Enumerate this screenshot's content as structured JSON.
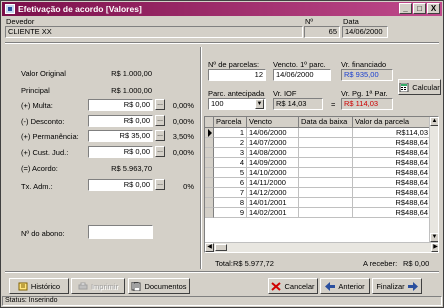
{
  "window": {
    "title": "Efetivação de acordo [Valores]",
    "controls": [
      "_",
      "□",
      "X"
    ]
  },
  "header": {
    "devedor_label": "Devedor",
    "devedor_value": "CLIENTE XX",
    "numero_label": "Nº",
    "numero_value": "65",
    "data_label": "Data",
    "data_value": "14/06/2000"
  },
  "values": {
    "valor_original_label": "Valor Original",
    "valor_original": "R$ 1.000,00",
    "principal_label": "Principal",
    "principal": "R$ 1.000,00",
    "multa_label": "(+) Multa:",
    "multa": "R$ 0,00",
    "multa_pct": "0,00%",
    "desconto_label": "(-) Desconto:",
    "desconto": "R$ 0,00",
    "desconto_pct": "0,00%",
    "permanencia_label": "(+) Permanência:",
    "permanencia": "R$ 35,00",
    "permanencia_pct": "3,50%",
    "custjud_label": "(+) Cust. Jud.:",
    "custjud": "R$ 0,00",
    "custjud_pct": "0,00%",
    "acordo_label": "(=) Acordo:",
    "acordo": "R$ 5.963,70",
    "txadm_label": "Tx. Adm.:",
    "txadm": "R$ 0,00",
    "txadm_pct": "0%",
    "abono_label": "Nº do abono:",
    "abono_value": ""
  },
  "parcelas": {
    "num_label": "Nº de parcelas:",
    "num_value": "12",
    "venc_label": "Vencto. 1º parc.",
    "venc_value": "14/06/2000",
    "financiado_label": "Vr. financiado",
    "financiado_value": "R$ 935,00",
    "antecipada_label": "Parc. antecipada",
    "antecipada_value": "100",
    "iof_label": "Vr. IOF",
    "iof_value": "R$ 14,03",
    "eq_sign": "=",
    "vrpg_label": "Vr. Pg. 1ª Par.",
    "vrpg_value": "R$ 114,03",
    "calcular_label": "Calcular"
  },
  "grid": {
    "columns": [
      "Parcela",
      "Vencto",
      "Data da baixa",
      "Valor da parcela"
    ],
    "rows": [
      {
        "parcela": "1",
        "vencto": "14/06/2000",
        "baixa": "",
        "valor": "R$114,03"
      },
      {
        "parcela": "2",
        "vencto": "14/07/2000",
        "baixa": "",
        "valor": "R$488,64"
      },
      {
        "parcela": "3",
        "vencto": "14/08/2000",
        "baixa": "",
        "valor": "R$488,64"
      },
      {
        "parcela": "4",
        "vencto": "14/09/2000",
        "baixa": "",
        "valor": "R$488,64"
      },
      {
        "parcela": "5",
        "vencto": "14/10/2000",
        "baixa": "",
        "valor": "R$488,64"
      },
      {
        "parcela": "6",
        "vencto": "14/11/2000",
        "baixa": "",
        "valor": "R$488,64"
      },
      {
        "parcela": "7",
        "vencto": "14/12/2000",
        "baixa": "",
        "valor": "R$488,64"
      },
      {
        "parcela": "8",
        "vencto": "14/01/2001",
        "baixa": "",
        "valor": "R$488,64"
      },
      {
        "parcela": "9",
        "vencto": "14/02/2001",
        "baixa": "",
        "valor": "R$488,64"
      }
    ],
    "total_label": "Total:",
    "total_value": "R$ 5.977,72",
    "receber_label": "A receber:",
    "receber_value": "R$ 0,00"
  },
  "buttons": {
    "historico": "Histórico",
    "imprimir": "Imprimir",
    "documentos": "Documentos",
    "cancelar": "Cancelar",
    "anterior": "Anterior",
    "finalizar": "Finalizar"
  },
  "status": {
    "text": "Status: Inserindo"
  },
  "colors": {
    "title_start": "#7b0f4a",
    "title_end": "#c04a8c",
    "financiado": "#1a3fd0",
    "vrpg": "#cc0000",
    "face": "#d4d0c8"
  }
}
